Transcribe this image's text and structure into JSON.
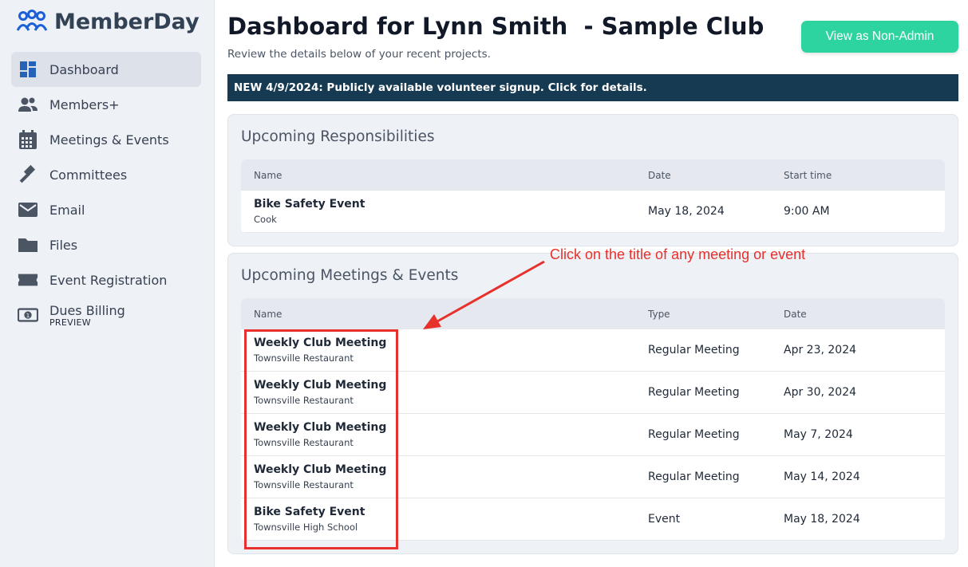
{
  "app": {
    "logo_text": "MemberDay"
  },
  "sidebar": {
    "items": [
      {
        "label": "Dashboard",
        "icon": "dashboard-icon",
        "active": true
      },
      {
        "label": "Members+",
        "icon": "members-icon"
      },
      {
        "label": "Meetings & Events",
        "icon": "calendar-icon"
      },
      {
        "label": "Committees",
        "icon": "gavel-icon"
      },
      {
        "label": "Email",
        "icon": "email-icon"
      },
      {
        "label": "Files",
        "icon": "folder-icon"
      },
      {
        "label": "Event Registration",
        "icon": "ticket-icon"
      },
      {
        "label": "Dues Billing",
        "sub": "PREVIEW",
        "icon": "money-icon"
      }
    ]
  },
  "header": {
    "title": "Dashboard for Lynn Smith  - Sample Club",
    "subtitle": "Review the details below of your recent projects.",
    "non_admin_button": "View as Non-Admin"
  },
  "banner": {
    "text": "NEW 4/9/2024: Publicly available volunteer signup. Click for details."
  },
  "responsibilities": {
    "title": "Upcoming Responsibilities",
    "columns": [
      "Name",
      "Date",
      "Start time"
    ],
    "rows": [
      {
        "name": "Bike Safety Event",
        "sub": "Cook",
        "date": "May 18, 2024",
        "time": "9:00 AM"
      }
    ]
  },
  "meetings": {
    "title": "Upcoming Meetings & Events",
    "columns": [
      "Name",
      "Type",
      "Date"
    ],
    "rows": [
      {
        "name": "Weekly Club Meeting",
        "sub": "Townsville Restaurant",
        "type": "Regular Meeting",
        "date": "Apr 23, 2024"
      },
      {
        "name": "Weekly Club Meeting",
        "sub": "Townsville Restaurant",
        "type": "Regular Meeting",
        "date": "Apr 30, 2024"
      },
      {
        "name": "Weekly Club Meeting",
        "sub": "Townsville Restaurant",
        "type": "Regular Meeting",
        "date": "May 7, 2024"
      },
      {
        "name": "Weekly Club Meeting",
        "sub": "Townsville Restaurant",
        "type": "Regular Meeting",
        "date": "May 14, 2024"
      },
      {
        "name": "Bike Safety Event",
        "sub": "Townsville High School",
        "type": "Event",
        "date": "May 18, 2024"
      }
    ]
  },
  "annotation": {
    "text": "Click on the title of any meeting or event"
  },
  "colors": {
    "accent": "#2dd4a0",
    "banner": "#163a52",
    "logo": "#1d5fd6",
    "annotation": "#e8312c"
  }
}
